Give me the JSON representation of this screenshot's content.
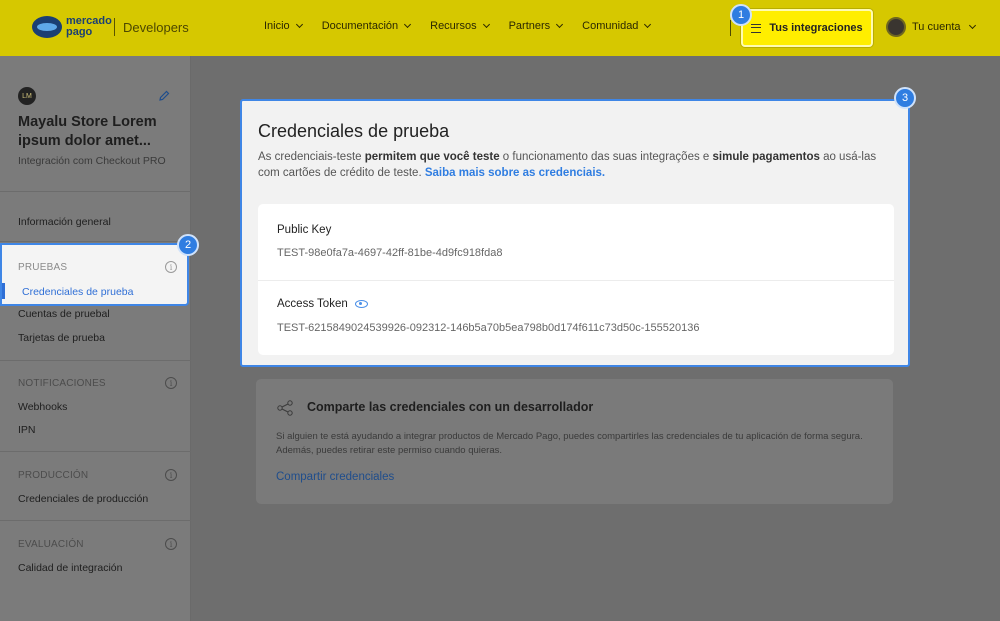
{
  "header": {
    "logo_text": "mercado pago",
    "developers": "Developers",
    "nav": [
      "Inicio",
      "Documentación",
      "Recursos",
      "Partners",
      "Comunidad"
    ],
    "integrations_label": "Tus integraciones",
    "account_label": "Tu cuenta",
    "brand_color": "#009ee3"
  },
  "badges": [
    "1",
    "2",
    "3"
  ],
  "sidebar": {
    "store_logo": "LM",
    "store_name": "Mayalu Store Lorem ipsum dolor amet...",
    "store_sub": "Integración com Checkout PRO",
    "general": "Información general",
    "sections": [
      {
        "title": "PRUEBAS",
        "items": [
          "Credenciales de prueba",
          "Cuentas de pruebal",
          "Tarjetas de prueba"
        ]
      },
      {
        "title": "NOTIFICACIONES",
        "items": [
          "Webhooks",
          "IPN"
        ]
      },
      {
        "title": "PRODUCCIÓN",
        "items": [
          "Credenciales de producción"
        ]
      },
      {
        "title": "EVALUACIÓN",
        "items": [
          "Calidad de integración"
        ]
      }
    ]
  },
  "credentials": {
    "title": "Credenciales de prueba",
    "desc_1": "As credenciais-teste ",
    "desc_2": "permitem que você teste",
    "desc_3": " o funcionamento das suas integrações e ",
    "desc_4": "simule pagamentos",
    "desc_5": " ao usá-las com cartões de crédito de teste. ",
    "desc_link": "Saiba mais sobre as credenciais.",
    "public_key_label": "Public Key",
    "public_key": "TEST-98e0fa7a-4697-42ff-81be-4d9fc918fda8",
    "access_token_label": "Access Token",
    "access_token": "TEST-6215849024539926-092312-146b5a70b5ea798b0d174f611c73d50c-155520136"
  },
  "share": {
    "title": "Comparte las credenciales con un desarrollador",
    "desc": "Si alguien te está ayudando a integrar productos de Mercado Pago, puedes compartirles las credenciales de tu aplicación de forma segura. Además, puedes retirar este permiso cuando quieras.",
    "link": "Compartir credenciales"
  }
}
